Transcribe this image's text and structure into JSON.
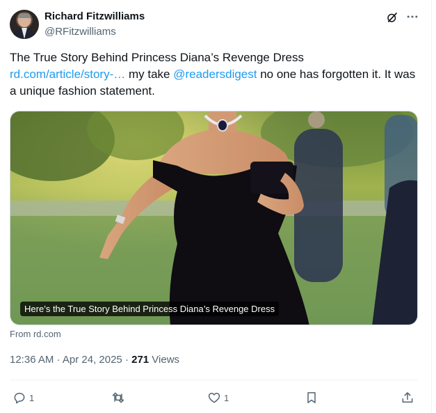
{
  "author": {
    "name": "Richard Fitzwilliams",
    "handle": "@RFitzwilliams"
  },
  "icons": {
    "grok": "grok-icon",
    "more": "more-icon",
    "reply": "reply-icon",
    "repost": "repost-icon",
    "like": "heart-icon",
    "bookmark": "bookmark-icon",
    "share": "share-icon"
  },
  "tweet": {
    "line1": "The True Story Behind Princess Diana’s Revenge Dress",
    "link": "rd.com/article/story-…",
    "mid_text": " my take ",
    "mention": "@readersdigest",
    "tail": " no one has forgotten it. It was a unique fashion statement."
  },
  "card": {
    "caption": "Here’s the True Story Behind Princess Diana’s Revenge Dress",
    "source": "From rd.com"
  },
  "meta": {
    "time": "12:36 AM · Apr 24, 2025 · ",
    "views_count": "271",
    "views_label": " Views"
  },
  "actions": {
    "replies": "1",
    "likes": "1"
  },
  "colors": {
    "link": "#1d9bf0",
    "secondary": "#536471",
    "text": "#0f1419"
  }
}
